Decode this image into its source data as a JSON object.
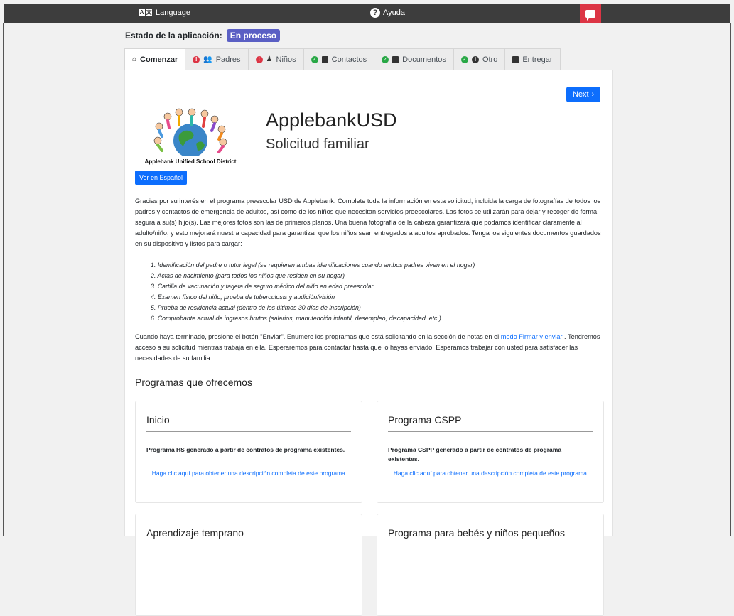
{
  "topbar": {
    "language_icon_glyphs": [
      "A",
      "文"
    ],
    "language_label": "Language",
    "help_label": "Ayuda",
    "accent_color": "#dc3545"
  },
  "status": {
    "label": "Estado de la aplicación:",
    "badge": "En proceso",
    "badge_color": "#5a5fc4"
  },
  "tabs": [
    {
      "label": "Comenzar",
      "icon": "home-icon",
      "active": true
    },
    {
      "label": "Padres",
      "icon": "users-icon",
      "status_icon": "exclamation-icon"
    },
    {
      "label": "Niños",
      "icon": "child-icon",
      "status_icon": "exclamation-icon"
    },
    {
      "label": "Contactos",
      "icon": "address-card-icon",
      "status_icon": "check-icon"
    },
    {
      "label": "Documentos",
      "icon": "file-icon",
      "status_icon": "check-icon"
    },
    {
      "label": "Otro",
      "icon": "info-icon",
      "status_icon": "check-icon"
    },
    {
      "label": "Entregar",
      "icon": "clipboard-icon"
    }
  ],
  "main": {
    "next_label": "Next",
    "logo_caption": "Applebank Unified School District",
    "title": "ApplebankUSD",
    "subtitle": "Solicitud familiar",
    "spanish_button": "Ver en Español",
    "intro": "Gracias por su interés en el programa preescolar USD de Applebank. Complete toda la información en esta solicitud, incluida la carga de fotografías de todos los padres y contactos de emergencia de adultos, así como de los niños que necesitan servicios preescolares. Las fotos se utilizarán para dejar y recoger de forma segura a su(s) hijo(s). Las mejores fotos son las de primeros planos. Una buena fotografía de la cabeza garantizará que podamos identificar claramente al adulto/niño, y esto mejorará nuestra capacidad para garantizar que los niños sean entregados a adultos aprobados. Tenga los siguientes documentos guardados en su dispositivo y listos para cargar:",
    "documents": [
      "1. Identificación del padre o tutor legal (se requieren ambas identificaciones cuando ambos padres viven en el hogar)",
      "2. Actas de nacimiento (para todos los niños que residen en su hogar)",
      "3. Cartilla de vacunación y tarjeta de seguro médico del niño en edad preescolar",
      "4. Examen físico del niño, prueba de tuberculosis y audición/visión",
      "5. Prueba de residencia actual (dentro de los últimos 30 días de inscripción)",
      "6. Comprobante actual de ingresos brutos (salarios, manutención infantil, desempleo, discapacidad, etc.)"
    ],
    "outro_before_link": "Cuando haya terminado, presione el botón \"Enviar\". Enumere los programas que está solicitando en la sección de notas en el ",
    "outro_link": "modo Firmar y enviar",
    "outro_after_link": " . Tendremos acceso a su solicitud mientras trabaja en ella. Esperaremos para contactar hasta que lo hayas enviado. Esperamos trabajar con usted para satisfacer las necesidades de su familia.",
    "programs_heading": "Programas que ofrecemos",
    "programs": [
      {
        "title": "Inicio",
        "description": "Programa HS generado a partir de contratos de programa existentes.",
        "link": "Haga clic aquí para obtener una descripción completa de este programa."
      },
      {
        "title": "Programa CSPP",
        "description": "Programa CSPP generado a partir de contratos de programa existentes.",
        "link": "Haga clic aquí para obtener una descripción completa de este programa."
      },
      {
        "title": "Aprendizaje temprano"
      },
      {
        "title": "Programa para bebés y niños pequeños"
      }
    ]
  }
}
